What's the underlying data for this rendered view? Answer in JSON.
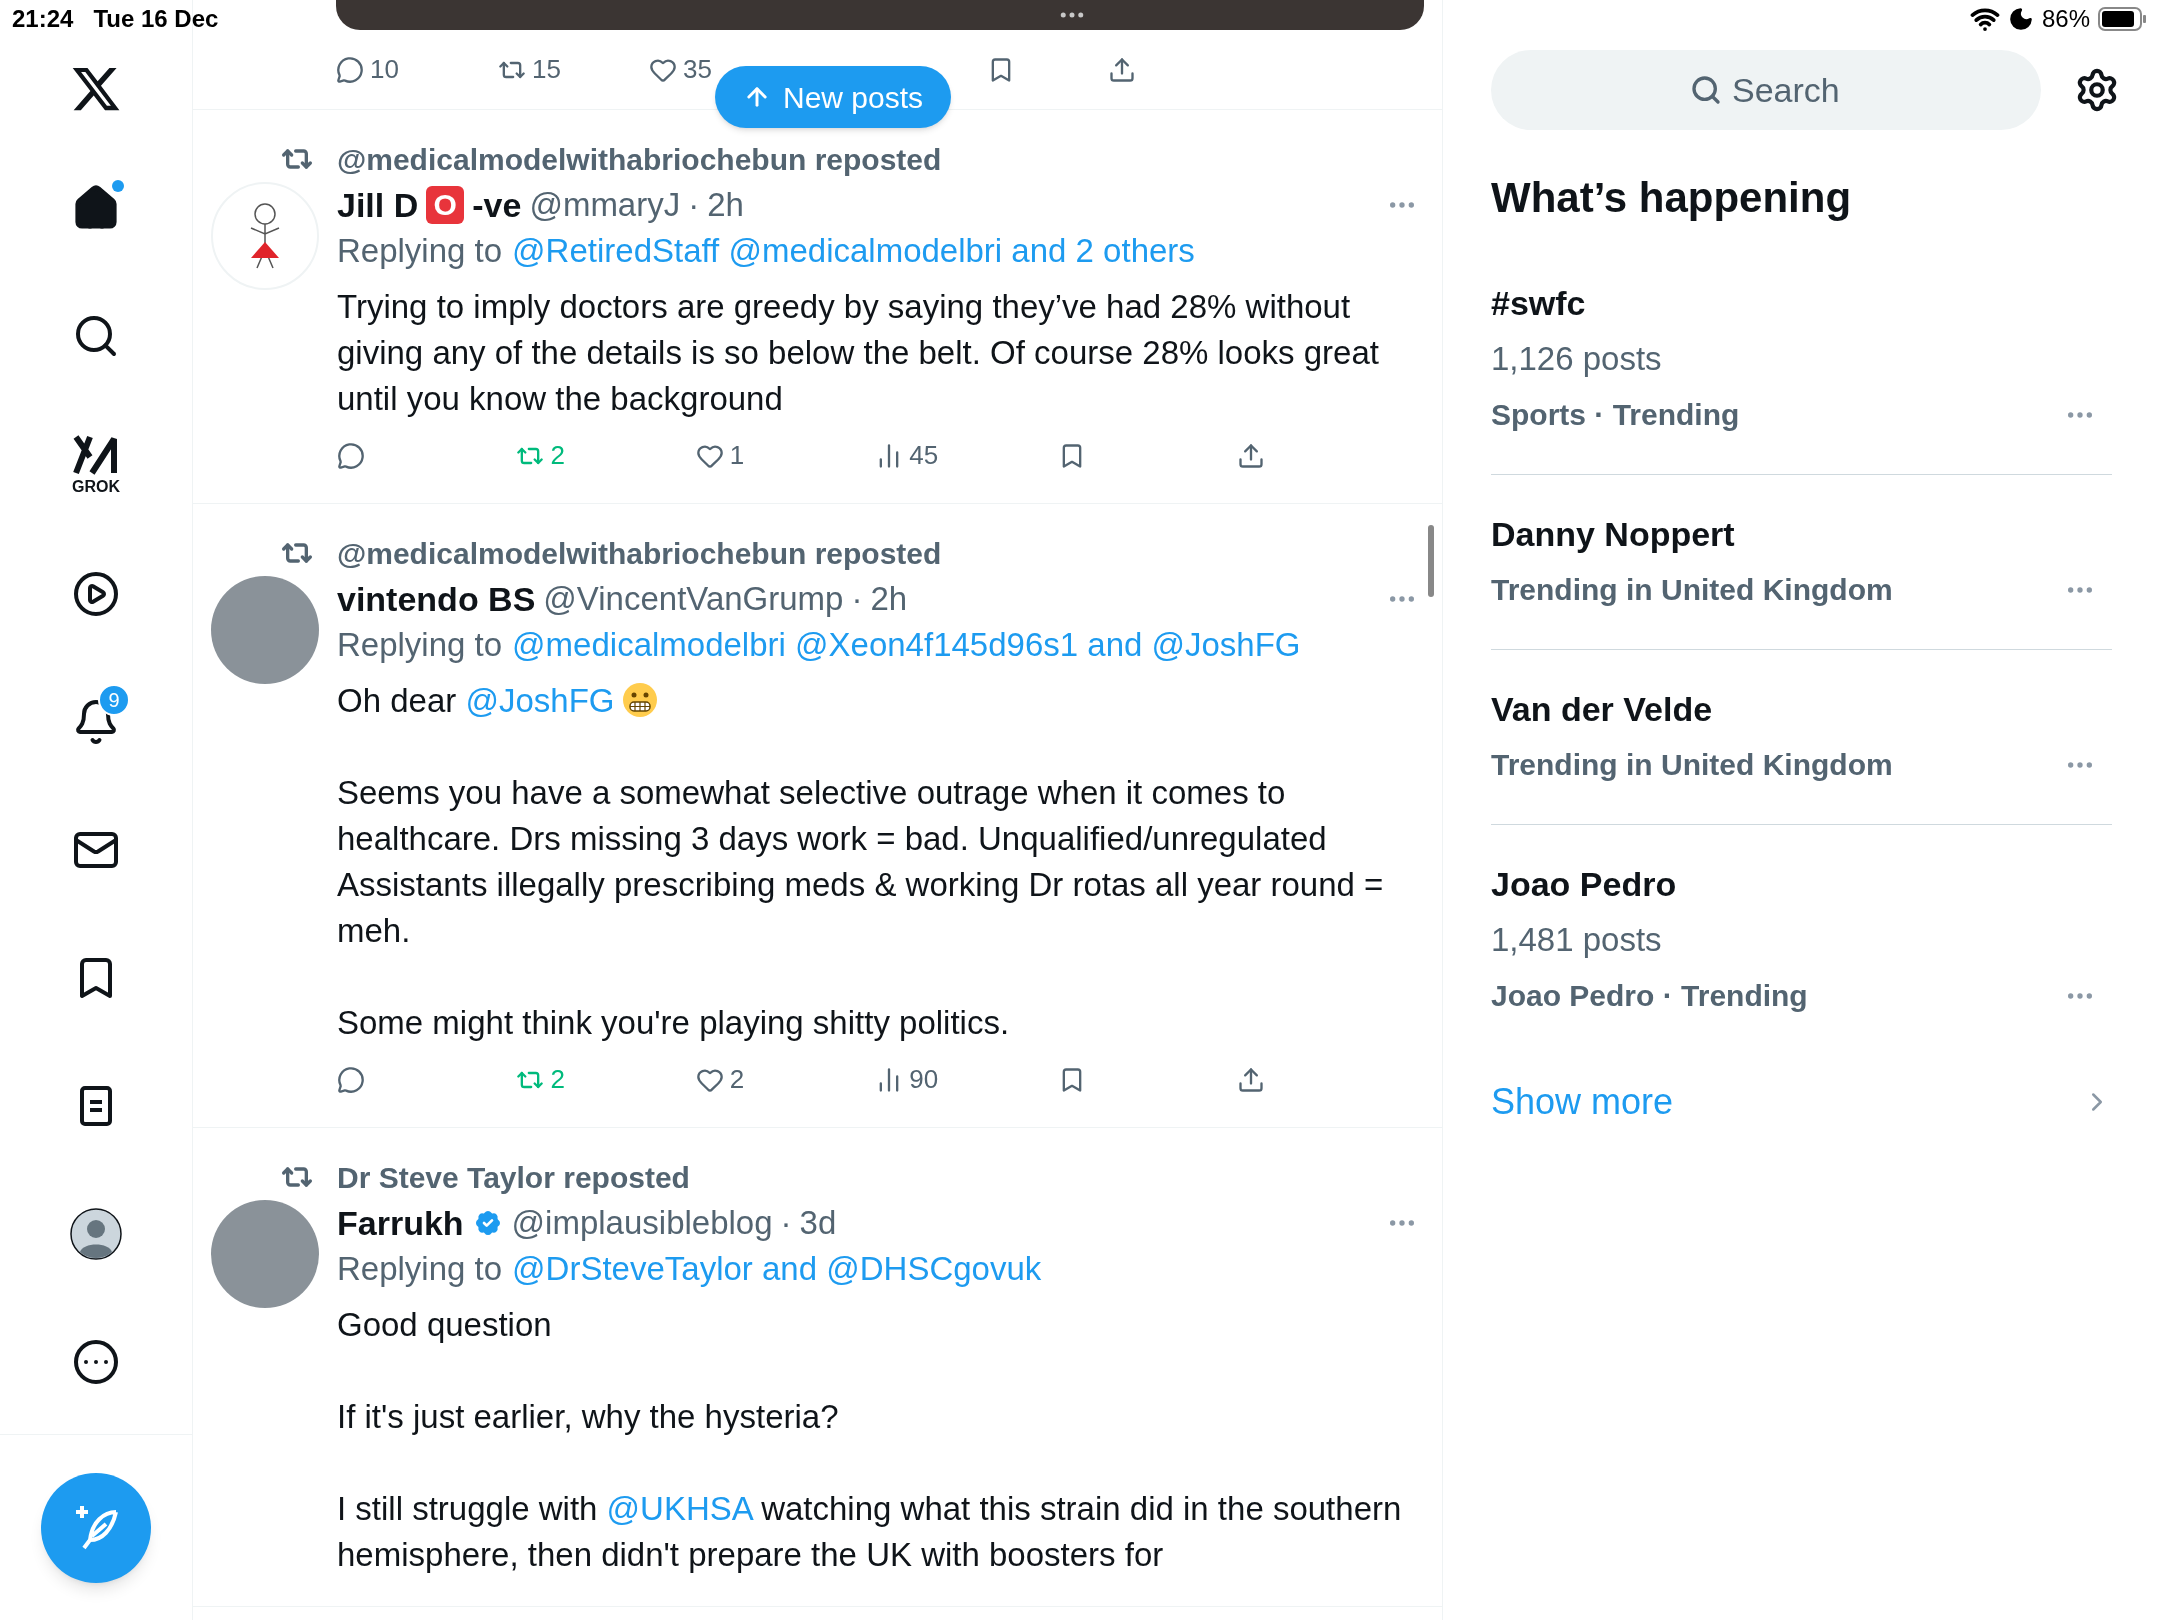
{
  "status_bar": {
    "time": "21:24",
    "date": "Tue 16 Dec",
    "battery": "86%"
  },
  "sidebar": {
    "items": [
      {
        "kind": "logo"
      },
      {
        "kind": "home",
        "selected": true,
        "dot": true
      },
      {
        "kind": "search",
        "selected": false
      },
      {
        "kind": "grok",
        "label": "GROK",
        "selected": false
      },
      {
        "kind": "video",
        "selected": false
      },
      {
        "kind": "notifications",
        "badge": "9",
        "selected": false
      },
      {
        "kind": "messages",
        "selected": false
      },
      {
        "kind": "bookmarks",
        "selected": false
      },
      {
        "kind": "lists",
        "selected": false
      },
      {
        "kind": "profile",
        "selected": false
      },
      {
        "kind": "more",
        "selected": false
      }
    ]
  },
  "feed": {
    "top_post": {
      "stats": [
        {
          "kind": "reply",
          "count": "10"
        },
        {
          "kind": "repost",
          "count": "15",
          "active": false
        },
        {
          "kind": "like",
          "count": "35"
        },
        {
          "kind": "bookmark"
        },
        {
          "kind": "share"
        }
      ]
    },
    "new_posts_button": "New posts",
    "posts": [
      {
        "reposted_by": "@medicalmodelwithabriochebun reposted",
        "avatar": {
          "kind": "drawing"
        },
        "name": [
          {
            "kind": "text",
            "text": "Jill D"
          },
          {
            "kind": "blood-badge",
            "text": "O"
          },
          {
            "kind": "text",
            "text": "-ve"
          }
        ],
        "verified": false,
        "handle": "@mmaryJ",
        "separator": "·",
        "time": "2h",
        "replying_label": "Replying to",
        "replying_to": "@RetiredStaff @medicalmodelbri and 2 others",
        "paragraphs": [
          [
            {
              "kind": "text",
              "text": "Trying to imply doctors are greedy by saying they’ve had 28% without giving any of the details is so below the belt. Of course 28% looks great until you know the background"
            }
          ]
        ],
        "stats": [
          {
            "kind": "reply"
          },
          {
            "kind": "repost",
            "count": "2",
            "active": true
          },
          {
            "kind": "like",
            "count": "1"
          },
          {
            "kind": "views",
            "count": "45"
          },
          {
            "kind": "bookmark"
          },
          {
            "kind": "share"
          }
        ]
      },
      {
        "reposted_by": "@medicalmodelwithabriochebun reposted",
        "avatar": {
          "kind": "photo"
        },
        "name": [
          {
            "kind": "text",
            "text": "vintendo BS"
          }
        ],
        "verified": false,
        "handle": "@VincentVanGrump",
        "separator": "·",
        "time": "2h",
        "replying_label": "Replying to",
        "replying_to": "@medicalmodelbri @Xeon4f145d96s1 and @JoshFG",
        "paragraphs": [
          [
            {
              "kind": "text",
              "text": "Oh dear "
            },
            {
              "kind": "link",
              "text": "@JoshFG"
            },
            {
              "kind": "emoji"
            }
          ],
          [
            {
              "kind": "text",
              "text": "Seems you have a somewhat selective outrage when it comes to healthcare. Drs missing 3 days work = bad. Unqualified/unregulated Assistants illegally prescribing meds & working Dr rotas all year round = meh."
            }
          ],
          [
            {
              "kind": "text",
              "text": "Some might think you're playing shitty politics."
            }
          ]
        ],
        "stats": [
          {
            "kind": "reply"
          },
          {
            "kind": "repost",
            "count": "2",
            "active": true
          },
          {
            "kind": "like",
            "count": "2"
          },
          {
            "kind": "views",
            "count": "90"
          },
          {
            "kind": "bookmark"
          },
          {
            "kind": "share"
          }
        ]
      },
      {
        "reposted_by": "Dr Steve Taylor reposted",
        "avatar": {
          "kind": "photo"
        },
        "name": [
          {
            "kind": "text",
            "text": "Farrukh"
          }
        ],
        "verified": true,
        "handle": "@implausibleblog",
        "separator": "·",
        "time": "3d",
        "replying_label": "Replying to",
        "replying_to": "@DrSteveTaylor and @DHSCgovuk",
        "paragraphs": [
          [
            {
              "kind": "text",
              "text": "Good question"
            }
          ],
          [
            {
              "kind": "text",
              "text": "If it's just earlier, why the hysteria?"
            }
          ],
          [
            {
              "kind": "text",
              "text": "I still struggle with "
            },
            {
              "kind": "link",
              "text": "@UKHSA"
            },
            {
              "kind": "text",
              "text": " watching what this strain did in the southern hemisphere, then didn't prepare the UK with boosters for"
            }
          ]
        ]
      }
    ]
  },
  "right_panel": {
    "search": {
      "placeholder": "Search"
    },
    "heading": "What’s happening",
    "trends": [
      {
        "name": "#swfc",
        "posts": "1,126 posts",
        "context": "Sports · Trending"
      },
      {
        "name": "Danny Noppert",
        "context": "Trending in United Kingdom"
      },
      {
        "name": "Van der Velde",
        "context": "Trending in United Kingdom"
      },
      {
        "name": "Joao Pedro",
        "posts": "1,481 posts",
        "context": "Joao Pedro · Trending"
      }
    ],
    "show_more": "Show more"
  }
}
